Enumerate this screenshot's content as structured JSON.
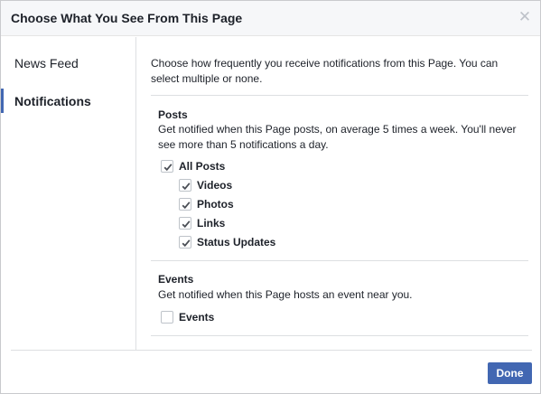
{
  "dialog": {
    "title": "Choose What You See From This Page",
    "close_icon": "close-icon"
  },
  "sidebar": {
    "items": [
      {
        "label": "News Feed",
        "selected": false
      },
      {
        "label": "Notifications",
        "selected": true
      }
    ]
  },
  "main": {
    "intro": "Choose how frequently you receive notifications from this Page. You can select multiple or none.",
    "posts": {
      "title": "Posts",
      "description": "Get notified when this Page posts, on average 5 times a week. You'll never see more than 5 notifications a day.",
      "options": [
        {
          "label": "All Posts",
          "checked": true
        },
        {
          "label": "Videos",
          "checked": true
        },
        {
          "label": "Photos",
          "checked": true
        },
        {
          "label": "Links",
          "checked": true
        },
        {
          "label": "Status Updates",
          "checked": true
        }
      ]
    },
    "events": {
      "title": "Events",
      "description": "Get notified when this Page hosts an event near you.",
      "options": [
        {
          "label": "Events",
          "checked": false
        }
      ]
    }
  },
  "footer": {
    "done_label": "Done"
  },
  "colors": {
    "accent": "#4267b2",
    "check": "#4b4f56",
    "header_bg": "#f6f7f9"
  }
}
